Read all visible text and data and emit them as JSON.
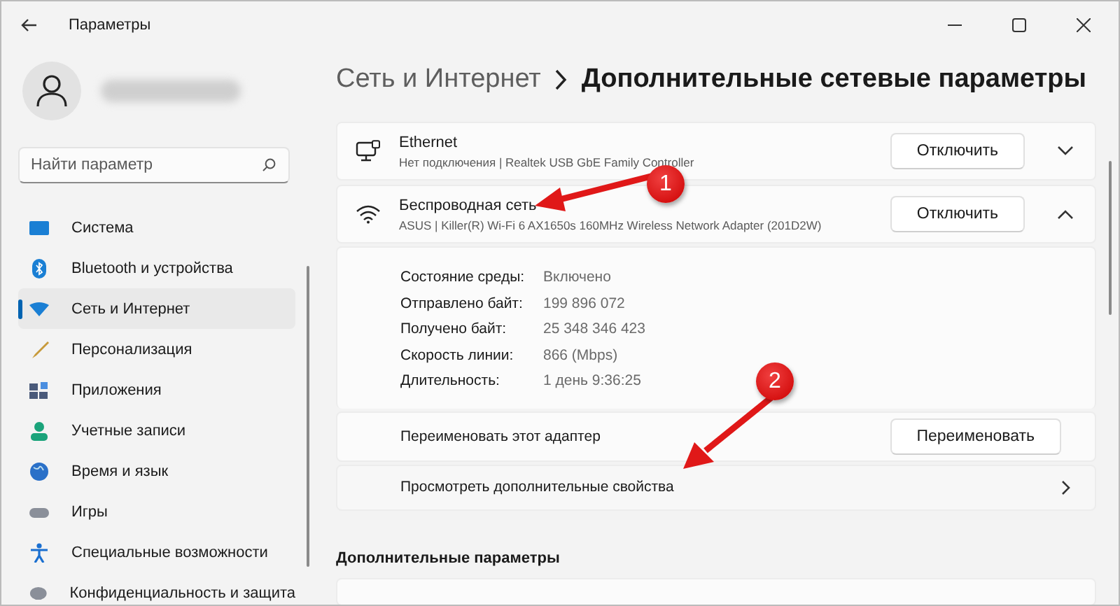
{
  "window": {
    "title": "Параметры"
  },
  "sidebar": {
    "search": {
      "placeholder": "Найти параметр"
    },
    "items": [
      {
        "label": "Система",
        "selected": false
      },
      {
        "label": "Bluetooth и устройства",
        "selected": false
      },
      {
        "label": "Сеть и Интернет",
        "selected": true
      },
      {
        "label": "Персонализация",
        "selected": false
      },
      {
        "label": "Приложения",
        "selected": false
      },
      {
        "label": "Учетные записи",
        "selected": false
      },
      {
        "label": "Время и язык",
        "selected": false
      },
      {
        "label": "Игры",
        "selected": false
      },
      {
        "label": "Специальные возможности",
        "selected": false
      },
      {
        "label": "Конфиденциальность и защита",
        "selected": false
      }
    ]
  },
  "breadcrumb": [
    "Сеть и Интернет",
    "Дополнительные сетевые параметры"
  ],
  "adapters": [
    {
      "kind": "ethernet",
      "name": "Ethernet",
      "description": "Нет подключения | Realtek USB GbE Family Controller",
      "button": "Отключить",
      "expanded": false
    },
    {
      "kind": "wifi",
      "name": "Беспроводная сеть",
      "description": "ASUS | Killer(R) Wi-Fi 6 AX1650s 160MHz Wireless Network Adapter (201D2W)",
      "button": "Отключить",
      "expanded": true,
      "details": [
        {
          "label": "Состояние среды:",
          "value": "Включено"
        },
        {
          "label": "Отправлено байт:",
          "value": "199 896 072"
        },
        {
          "label": "Получено байт:",
          "value": "25 348 346 423"
        },
        {
          "label": "Скорость линии:",
          "value": "866 (Mbps)"
        },
        {
          "label": "Длительность:",
          "value": "1 день 9:36:25"
        }
      ],
      "rename": {
        "label": "Переименовать этот адаптер",
        "button": "Переименовать"
      },
      "more_link": "Просмотреть дополнительные свойства"
    }
  ],
  "section_heading": "Дополнительные параметры",
  "annotations": [
    {
      "number": "1"
    },
    {
      "number": "2"
    }
  ]
}
